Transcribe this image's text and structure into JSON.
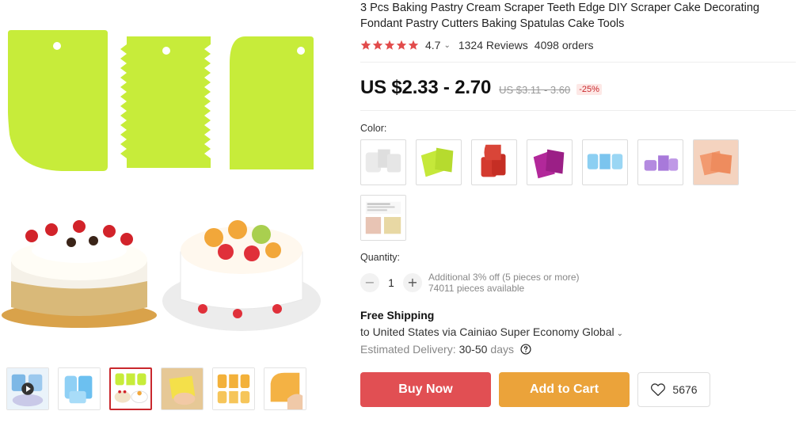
{
  "product": {
    "title": "3 Pcs Baking Pastry Cream Scraper Teeth Edge DIY Scraper Cake Decorating Fondant Pastry Cutters Baking Spatulas Cake Tools",
    "rating": "4.7",
    "reviews": "1324 Reviews",
    "orders": "4098 orders",
    "price": "US $2.33 - 2.70",
    "old_price": "US $3.11 - 3.60",
    "discount": "-25%"
  },
  "colors": {
    "label": "Color:",
    "options": [
      {
        "name": "white",
        "fill": "#e9e9e9"
      },
      {
        "name": "green",
        "fill": "#c5e83a"
      },
      {
        "name": "red",
        "fill": "#d43a2f"
      },
      {
        "name": "purple",
        "fill": "#b2289a"
      },
      {
        "name": "blue",
        "fill": "#8ccff2"
      },
      {
        "name": "violet",
        "fill": "#b48ae0"
      },
      {
        "name": "orange",
        "fill": "#f29a70"
      },
      {
        "name": "info-card",
        "fill": "#f0e6d8"
      }
    ]
  },
  "quantity": {
    "label": "Quantity:",
    "value": "1",
    "minus": "−",
    "plus": "+",
    "note_discount": "Additional 3% off (5 pieces or more)",
    "note_available": "74011 pieces available"
  },
  "shipping": {
    "title": "Free Shipping",
    "destination": "to United States via Cainiao Super Economy Global",
    "delivery_label": "Estimated Delivery:",
    "delivery_value": "30-50",
    "delivery_unit": "days"
  },
  "actions": {
    "buy_now": "Buy Now",
    "add_to_cart": "Add to Cart",
    "wishlist_count": "5676"
  },
  "icons": {
    "star": "star-icon",
    "help": "question-circle-icon",
    "heart": "heart-icon"
  },
  "theme": {
    "accent_red": "#e14f53",
    "accent_orange": "#eba33a",
    "star_color": "#e24b4b",
    "discount_color": "#c9282d"
  }
}
